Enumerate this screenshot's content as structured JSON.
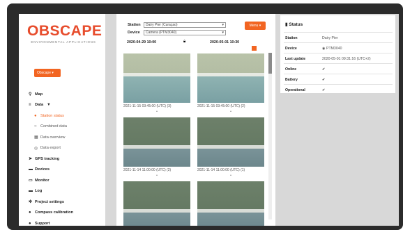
{
  "brand": {
    "name": "OBSCAPE",
    "tagline": "ENVIRONMENTAL APPLICATIONS",
    "accent": "#f26522"
  },
  "sidebar": {
    "org_select": "Obscape",
    "items": [
      {
        "label": "Map",
        "icon": "map-marker-icon",
        "glyph": "⚲"
      },
      {
        "label": "Data",
        "icon": "chart-icon",
        "glyph": "≡",
        "caret": "▼"
      },
      {
        "label": "Station status",
        "icon": "location-icon",
        "glyph": "●",
        "active": true
      },
      {
        "label": "Combined data",
        "icon": "location-icon",
        "glyph": "○"
      },
      {
        "label": "Data overview",
        "icon": "table-icon",
        "glyph": "▦"
      },
      {
        "label": "Data export",
        "icon": "export-icon",
        "glyph": "◎"
      },
      {
        "label": "GPS tracking",
        "icon": "send-icon",
        "glyph": "➤"
      },
      {
        "label": "Devices",
        "icon": "devices-icon",
        "glyph": "▬"
      },
      {
        "label": "Monitor",
        "icon": "monitor-icon",
        "glyph": "▭"
      },
      {
        "label": "Log",
        "icon": "log-icon",
        "glyph": "▬"
      },
      {
        "label": "Project settings",
        "icon": "gear-icon",
        "glyph": "✲"
      },
      {
        "label": "Compass calibration",
        "icon": "compass-icon",
        "glyph": "●"
      },
      {
        "label": "Support",
        "icon": "help-icon",
        "glyph": "●"
      }
    ]
  },
  "main": {
    "station_label": "Station",
    "station_value": "Dairy Pier (Curaçao)",
    "device_label": "Device",
    "device_value": "Camera (PTM3040)",
    "menu_label": "Menu ▾",
    "date_from": "2020-04-29 10:00",
    "date_to": "2020-05-01 10:30",
    "thumbnails": [
      {
        "caption": "2021-11-15 03:45:00 (UTC) (3)"
      },
      {
        "caption": "2021-11-15 03:45:00 (UTC) (2)"
      },
      {
        "caption": "2021-11-14 11:00:00 (UTC) (2)"
      },
      {
        "caption": "2021-11-14 11:00:00 (UTC) (1)"
      },
      {
        "caption": ""
      },
      {
        "caption": ""
      }
    ]
  },
  "status": {
    "title": "Status",
    "rows": [
      {
        "key": "Station",
        "value": "Dairy Pier"
      },
      {
        "key": "Device",
        "value": "PTM3040"
      },
      {
        "key": "Last update",
        "value": "2020-05-01 09:31:16 (UTC+2)"
      },
      {
        "key": "Online",
        "value": "✔"
      },
      {
        "key": "Battery",
        "value": "✔"
      },
      {
        "key": "Operational",
        "value": "✔"
      }
    ]
  }
}
